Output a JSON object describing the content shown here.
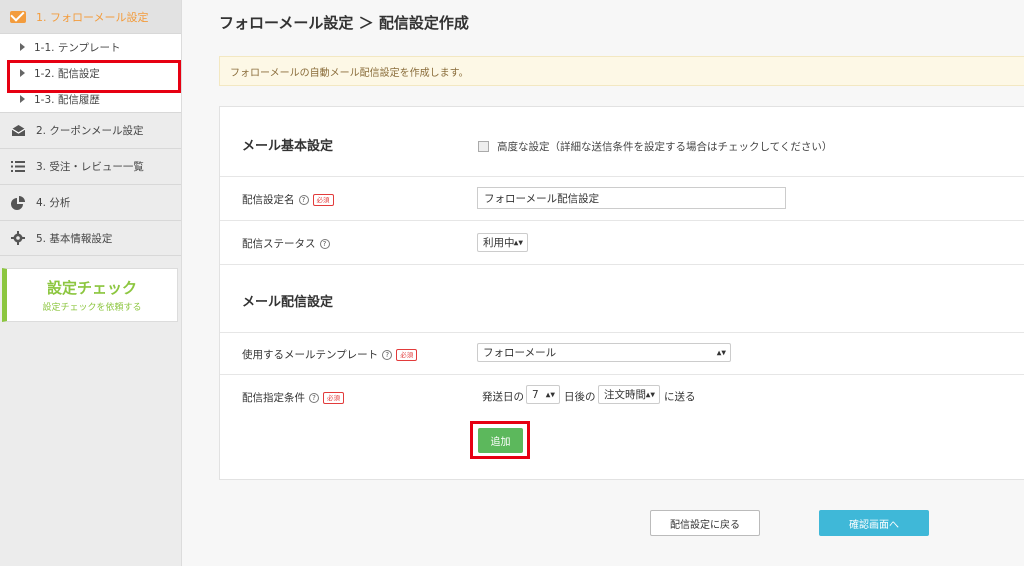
{
  "sidebar": {
    "top_item": "1. フォローメール設定",
    "sub_items": [
      {
        "label": "1-1. テンプレート"
      },
      {
        "label": "1-2. 配信設定"
      },
      {
        "label": "1-3. 配信履歴"
      }
    ],
    "items": [
      {
        "label": "2. クーポンメール設定",
        "icon": "envelope-open-icon"
      },
      {
        "label": "3. 受注・レビュー一覧",
        "icon": "list-icon"
      },
      {
        "label": "4. 分析",
        "icon": "pie-chart-icon"
      },
      {
        "label": "5. 基本情報設定",
        "icon": "gear-icon"
      }
    ],
    "check": {
      "title": "設定チェック",
      "subtitle": "設定チェックを依頼する"
    }
  },
  "main": {
    "title": "フォローメール設定 ＞ 配信設定作成",
    "notice": "フォローメールの自動メール配信設定を作成します。",
    "basic": {
      "title": "メール基本設定",
      "advanced_checkbox": "高度な設定（詳細な送信条件を設定する場合はチェックしてください）",
      "name_label": "配信設定名",
      "name_value": "フォローメール配信設定",
      "status_label": "配信ステータス",
      "status_value": "利用中"
    },
    "delivery": {
      "title": "メール配信設定",
      "template_label": "使用するメールテンプレート",
      "template_value": "フォローメール",
      "condition_label": "配信指定条件",
      "cond_prefix": "発送日の",
      "cond_days": "7",
      "cond_mid": "日後の",
      "cond_time": "注文時間",
      "cond_suffix": "に送る",
      "add_button": "追加"
    },
    "required": "必須",
    "back_button": "配信設定に戻る",
    "confirm_button": "確認画面へ"
  }
}
